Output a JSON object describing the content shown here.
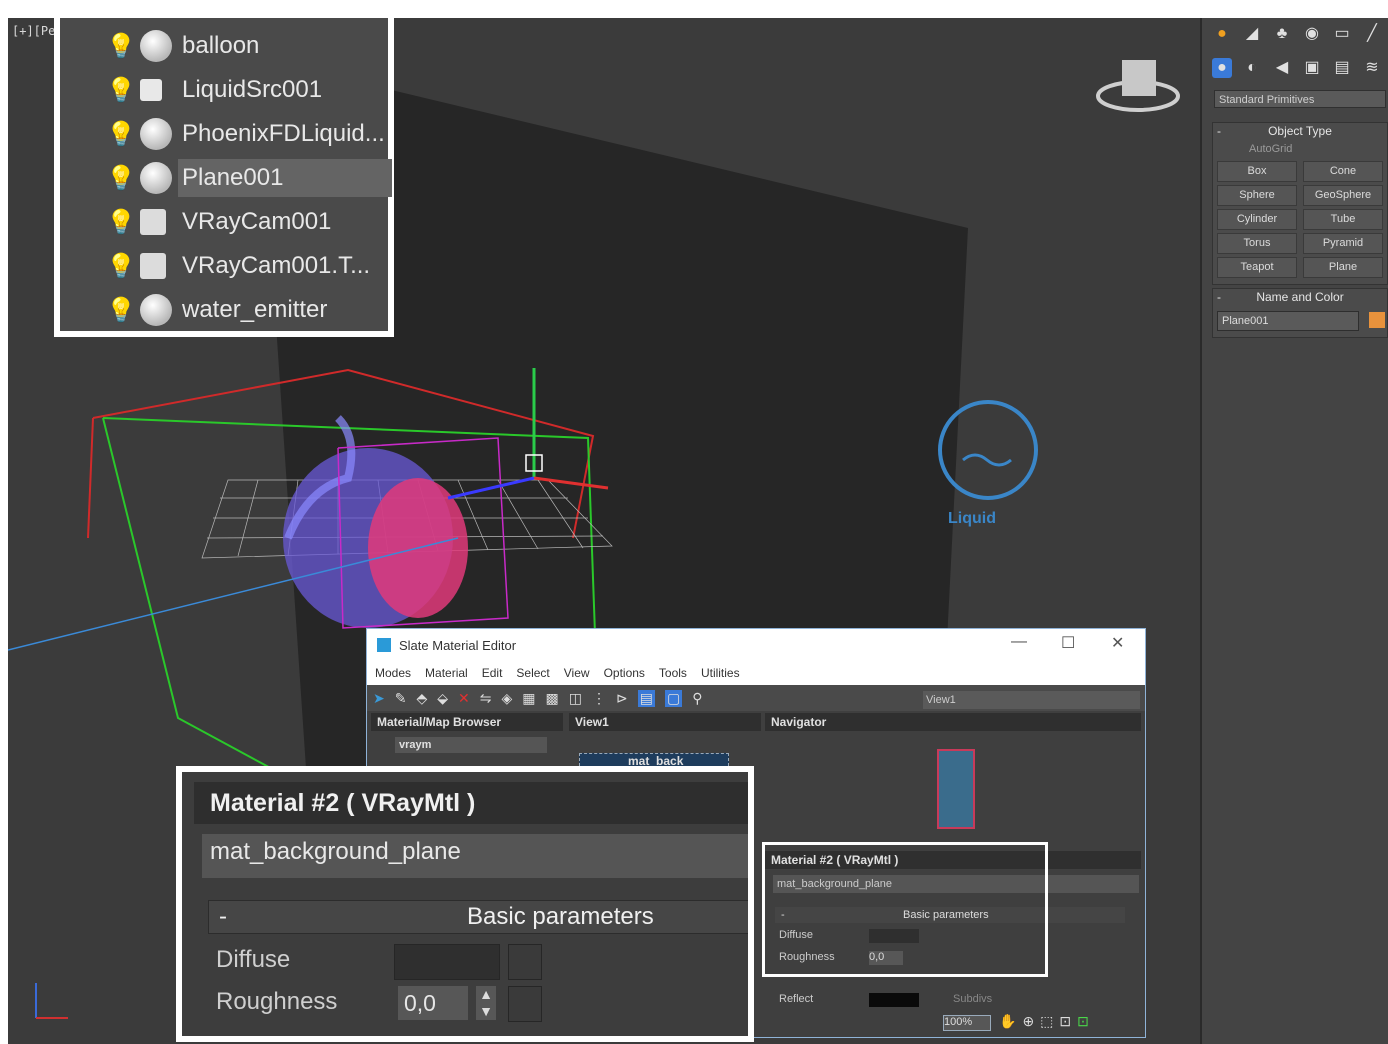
{
  "viewport": {
    "label": "[+][Pe",
    "liquid_label": "Liquid"
  },
  "scene_explorer": {
    "items": [
      {
        "name": "balloon",
        "icon": "sphere-icon",
        "selected": false
      },
      {
        "name": "LiquidSrc001",
        "icon": "liquid-source-icon",
        "selected": false
      },
      {
        "name": "PhoenixFDLiquid...",
        "icon": "sphere-icon",
        "selected": false
      },
      {
        "name": "Plane001",
        "icon": "sphere-icon",
        "selected": true
      },
      {
        "name": "VRayCam001",
        "icon": "camera-icon",
        "selected": false
      },
      {
        "name": "VRayCam001.T...",
        "icon": "camera-icon",
        "selected": false
      },
      {
        "name": "water_emitter",
        "icon": "sphere-icon",
        "selected": false
      }
    ]
  },
  "command_panel": {
    "category_dropdown": "Standard Primitives",
    "object_type": {
      "title": "Object Type",
      "autogrid": "AutoGrid",
      "buttons": [
        "Box",
        "Cone",
        "Sphere",
        "GeoSphere",
        "Cylinder",
        "Tube",
        "Torus",
        "Pyramid",
        "Teapot",
        "Plane"
      ]
    },
    "name_and_color": {
      "title": "Name and Color",
      "name": "Plane001",
      "color": "#e8923c"
    }
  },
  "slate_editor": {
    "title": "Slate Material Editor",
    "menu": [
      "Modes",
      "Material",
      "Edit",
      "Select",
      "View",
      "Options",
      "Tools",
      "Utilities"
    ],
    "view_dropdown": "View1",
    "browser_title": "Material/Map Browser",
    "browser_search": "vraym",
    "view_tab": "View1",
    "node_label": "mat_back",
    "navigator_title": "Navigator",
    "material_title": "Material #2  ( VRayMtl )",
    "material_name": "mat_background_plane",
    "rollout": "Basic parameters",
    "rollout_minus": "-",
    "diffuse_label": "Diffuse",
    "roughness_label": "Roughness",
    "roughness_value": "0,0",
    "reflect_label": "Reflect",
    "subdivs_label": "Subdivs",
    "zoom": "100%"
  },
  "callout": {
    "title": "Material #2  ( VRayMtl )",
    "name": "mat_background_plane",
    "rollout_minus": "-",
    "rollout": "Basic parameters",
    "diffuse_label": "Diffuse",
    "roughness_label": "Roughness",
    "roughness_value": "0,0"
  },
  "colors": {
    "viewport_bg": "#3b3b3b",
    "accent_orange": "#e8923c",
    "selection": "#646464"
  }
}
